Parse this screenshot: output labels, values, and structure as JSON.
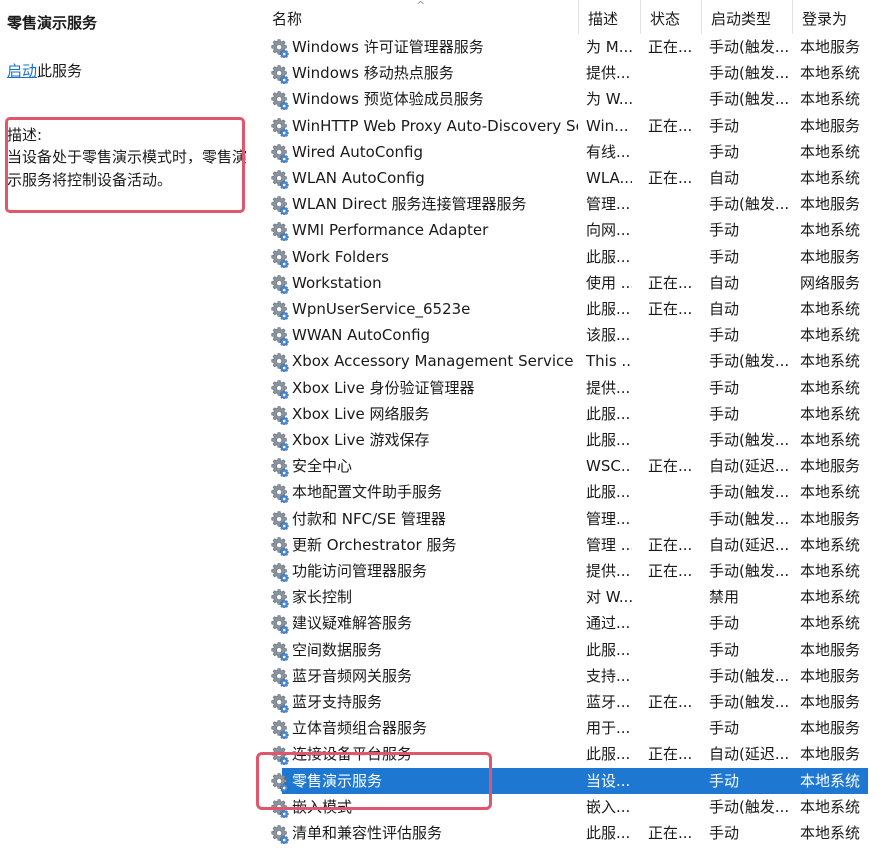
{
  "left_panel": {
    "title": "零售演示服务",
    "start_link": "启动",
    "start_suffix": "此服务",
    "description_label": "描述:",
    "description_text": "当设备处于零售演示模式时，零售演示服务将控制设备活动。"
  },
  "columns": {
    "name": "名称",
    "description": "描述",
    "status": "状态",
    "startup_type": "启动类型",
    "logon_as": "登录为"
  },
  "accent_color": "#1e78d2",
  "highlight_color": "#e0566d",
  "rows": [
    {
      "name": "Windows 许可证管理器服务",
      "description": "为 M...",
      "status": "正在...",
      "startup_type": "手动(触发...",
      "logon_as": "本地服务"
    },
    {
      "name": "Windows 移动热点服务",
      "description": "提供...",
      "status": "",
      "startup_type": "手动(触发...",
      "logon_as": "本地系统"
    },
    {
      "name": "Windows 预览体验成员服务",
      "description": "为 W...",
      "status": "",
      "startup_type": "手动(触发...",
      "logon_as": "本地系统"
    },
    {
      "name": "WinHTTP Web Proxy Auto-Discovery Se...",
      "description": "Win...",
      "status": "正在...",
      "startup_type": "手动",
      "logon_as": "本地服务"
    },
    {
      "name": "Wired AutoConfig",
      "description": "有线...",
      "status": "",
      "startup_type": "手动",
      "logon_as": "本地系统"
    },
    {
      "name": "WLAN AutoConfig",
      "description": "WLA...",
      "status": "正在...",
      "startup_type": "自动",
      "logon_as": "本地系统"
    },
    {
      "name": "WLAN Direct 服务连接管理器服务",
      "description": "管理...",
      "status": "",
      "startup_type": "手动(触发...",
      "logon_as": "本地服务"
    },
    {
      "name": "WMI Performance Adapter",
      "description": "向网...",
      "status": "",
      "startup_type": "手动",
      "logon_as": "本地系统"
    },
    {
      "name": "Work Folders",
      "description": "此服...",
      "status": "",
      "startup_type": "手动",
      "logon_as": "本地服务"
    },
    {
      "name": "Workstation",
      "description": "使用 ...",
      "status": "正在...",
      "startup_type": "自动",
      "logon_as": "网络服务"
    },
    {
      "name": "WpnUserService_6523e",
      "description": "此服...",
      "status": "正在...",
      "startup_type": "自动",
      "logon_as": "本地系统"
    },
    {
      "name": "WWAN AutoConfig",
      "description": "该服...",
      "status": "",
      "startup_type": "手动",
      "logon_as": "本地系统"
    },
    {
      "name": "Xbox Accessory Management Service",
      "description": "This ...",
      "status": "",
      "startup_type": "手动(触发...",
      "logon_as": "本地系统"
    },
    {
      "name": "Xbox Live 身份验证管理器",
      "description": "提供...",
      "status": "",
      "startup_type": "手动",
      "logon_as": "本地系统"
    },
    {
      "name": "Xbox Live 网络服务",
      "description": "此服...",
      "status": "",
      "startup_type": "手动",
      "logon_as": "本地系统"
    },
    {
      "name": "Xbox Live 游戏保存",
      "description": "此服...",
      "status": "",
      "startup_type": "手动(触发...",
      "logon_as": "本地系统"
    },
    {
      "name": "安全中心",
      "description": "WSC...",
      "status": "正在...",
      "startup_type": "自动(延迟...",
      "logon_as": "本地服务"
    },
    {
      "name": "本地配置文件助手服务",
      "description": "此服...",
      "status": "",
      "startup_type": "手动(触发...",
      "logon_as": "本地系统"
    },
    {
      "name": "付款和 NFC/SE 管理器",
      "description": "管理...",
      "status": "",
      "startup_type": "手动(触发...",
      "logon_as": "本地服务"
    },
    {
      "name": "更新 Orchestrator 服务",
      "description": "管理 ...",
      "status": "正在...",
      "startup_type": "自动(延迟...",
      "logon_as": "本地系统"
    },
    {
      "name": "功能访问管理器服务",
      "description": "提供...",
      "status": "正在...",
      "startup_type": "手动(触发...",
      "logon_as": "本地系统"
    },
    {
      "name": "家长控制",
      "description": "对 W...",
      "status": "",
      "startup_type": "禁用",
      "logon_as": "本地系统"
    },
    {
      "name": "建议疑难解答服务",
      "description": "通过...",
      "status": "",
      "startup_type": "手动",
      "logon_as": "本地系统"
    },
    {
      "name": "空间数据服务",
      "description": "此服...",
      "status": "",
      "startup_type": "手动",
      "logon_as": "本地服务"
    },
    {
      "name": "蓝牙音频网关服务",
      "description": "支持...",
      "status": "",
      "startup_type": "手动(触发...",
      "logon_as": "本地服务"
    },
    {
      "name": "蓝牙支持服务",
      "description": "蓝牙...",
      "status": "正在...",
      "startup_type": "手动(触发...",
      "logon_as": "本地服务"
    },
    {
      "name": "立体音频组合器服务",
      "description": "用于...",
      "status": "",
      "startup_type": "手动",
      "logon_as": "本地服务"
    },
    {
      "name": "连接设备平台服务",
      "description": "此服...",
      "status": "正在...",
      "startup_type": "自动(延迟...",
      "logon_as": "本地服务"
    },
    {
      "name": "零售演示服务",
      "description": "当设...",
      "status": "",
      "startup_type": "手动",
      "logon_as": "本地系统",
      "selected": true
    },
    {
      "name": "嵌入模式",
      "description": "嵌入...",
      "status": "",
      "startup_type": "手动(触发...",
      "logon_as": "本地系统"
    },
    {
      "name": "清单和兼容性评估服务",
      "description": "此服...",
      "status": "正在...",
      "startup_type": "手动",
      "logon_as": "本地系统"
    }
  ]
}
